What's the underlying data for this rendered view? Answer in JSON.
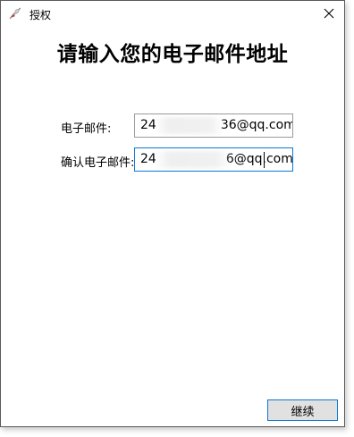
{
  "window": {
    "title": "授权",
    "app_icon": "feather-pen-icon",
    "close_icon": "close-icon"
  },
  "heading": "请输入您的电子邮件地址",
  "form": {
    "email_label": "电子邮件:",
    "email_value_prefix": "24",
    "email_value_suffix": "36@qq.com",
    "confirm_label": "确认电子邮件:",
    "confirm_value_prefix": "24",
    "confirm_value_suffix": "6@qq.com"
  },
  "buttons": {
    "continue_label": "继续"
  },
  "colors": {
    "accent": "#0a78d7",
    "button_face": "#e1e1e1"
  }
}
